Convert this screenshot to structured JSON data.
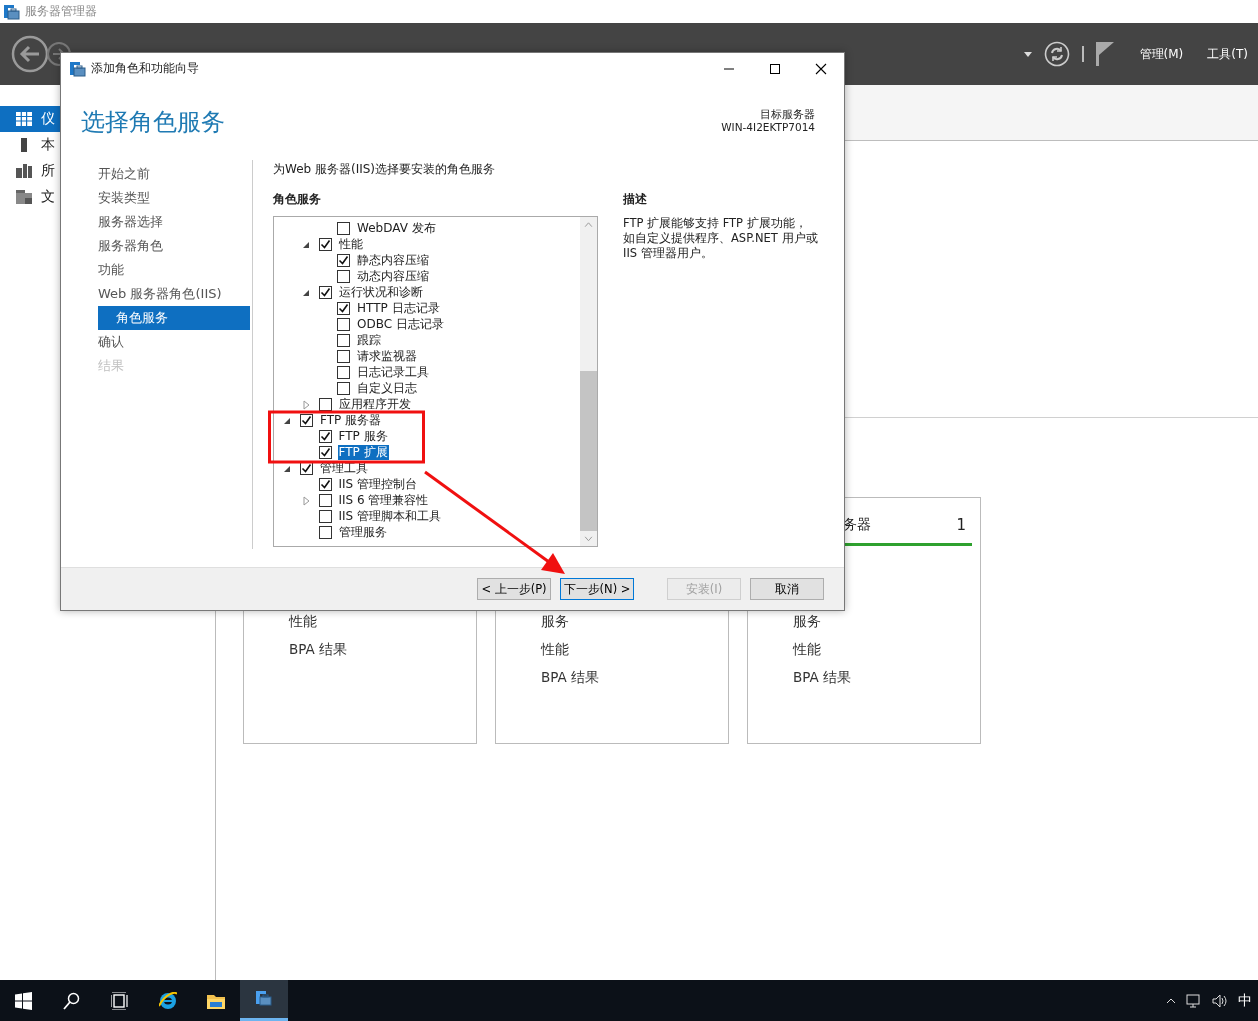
{
  "app_title": "服务器管理器",
  "header": {
    "menus": [
      "管理(M)",
      "工具(T)"
    ]
  },
  "sidebar": {
    "items": [
      {
        "label": "仪",
        "kind": "dashboard",
        "selected": true
      },
      {
        "label": "本",
        "kind": "server",
        "selected": false
      },
      {
        "label": "所",
        "kind": "servers",
        "selected": false
      },
      {
        "label": "文",
        "kind": "files",
        "selected": false
      }
    ]
  },
  "tiles": [
    {
      "lines": [
        "性能",
        "BPA 结果"
      ]
    },
    {
      "lines": [
        "服务",
        "性能",
        "BPA 结果"
      ]
    },
    {
      "title": "务器",
      "count": "1",
      "color": "#2ea12e",
      "lines": [
        "服务",
        "性能",
        "BPA 结果"
      ]
    }
  ],
  "dialog": {
    "title": "添加角色和功能向导",
    "heading": "选择角色服务",
    "target_label": "目标服务器",
    "target_name": "WIN-4I2EKTP7014",
    "steps": [
      {
        "label": "开始之前",
        "selected": false,
        "disabled": false
      },
      {
        "label": "安装类型",
        "selected": false,
        "disabled": false
      },
      {
        "label": "服务器选择",
        "selected": false,
        "disabled": false
      },
      {
        "label": "服务器角色",
        "selected": false,
        "disabled": false
      },
      {
        "label": "功能",
        "selected": false,
        "disabled": false
      },
      {
        "label": "Web 服务器角色(IIS)",
        "selected": false,
        "disabled": false,
        "children": [
          {
            "label": "角色服务",
            "selected": true,
            "disabled": false
          }
        ]
      },
      {
        "label": "确认",
        "selected": false,
        "disabled": false
      },
      {
        "label": "结果",
        "selected": false,
        "disabled": true
      }
    ],
    "instruction": "为Web 服务器(IIS)选择要安装的角色服务",
    "tree_label": "角色服务",
    "tree": [
      {
        "children": [
          {
            "children": [
              {
                "label": "WebDAV 发布",
                "checked": false,
                "selected": false
              }
            ]
          },
          {
            "label": "性能",
            "checked": true,
            "selected": false,
            "expanded": true,
            "children": [
              {
                "label": "静态内容压缩",
                "checked": true,
                "selected": false
              },
              {
                "label": "动态内容压缩",
                "checked": false,
                "selected": false
              }
            ]
          },
          {
            "label": "运行状况和诊断",
            "checked": true,
            "selected": false,
            "expanded": true,
            "children": [
              {
                "label": "HTTP 日志记录",
                "checked": true,
                "selected": false
              },
              {
                "label": "ODBC 日志记录",
                "checked": false,
                "selected": false
              },
              {
                "label": "跟踪",
                "checked": false,
                "selected": false
              },
              {
                "label": "请求监视器",
                "checked": false,
                "selected": false
              },
              {
                "label": "日志记录工具",
                "checked": false,
                "selected": false
              },
              {
                "label": "自定义日志",
                "checked": false,
                "selected": false
              }
            ]
          },
          {
            "label": "应用程序开发",
            "checked": false,
            "selected": false,
            "expanded": false
          }
        ]
      },
      {
        "label": "FTP 服务器",
        "checked": true,
        "selected": false,
        "expanded": true,
        "children": [
          {
            "label": "FTP 服务",
            "checked": true,
            "selected": false
          },
          {
            "label": "FTP 扩展",
            "checked": true,
            "selected": true
          }
        ]
      },
      {
        "label": "管理工具",
        "checked": true,
        "selected": false,
        "expanded": true,
        "children": [
          {
            "label": "IIS 管理控制台",
            "checked": true,
            "selected": false
          },
          {
            "label": "IIS 6 管理兼容性",
            "checked": false,
            "selected": false,
            "expanded": false
          },
          {
            "label": "IIS 管理脚本和工具",
            "checked": false,
            "selected": false
          },
          {
            "label": "管理服务",
            "checked": false,
            "selected": false
          }
        ]
      }
    ],
    "description_label": "描述",
    "description": "FTP 扩展能够支持 FTP 扩展功能，如自定义提供程序、ASP.NET 用户或 IIS 管理器用户。",
    "buttons": [
      {
        "label": "< 上一步(P)",
        "disabled": false,
        "focused": false
      },
      {
        "label": "下一步(N) >",
        "disabled": false,
        "focused": true
      },
      {
        "label": "安装(I)",
        "disabled": true,
        "focused": false
      },
      {
        "label": "取消",
        "disabled": false,
        "focused": false
      }
    ]
  },
  "taskbar": {
    "apps": [
      {
        "kind": "start",
        "selected": false
      },
      {
        "kind": "search",
        "selected": false
      },
      {
        "kind": "taskview",
        "selected": false
      },
      {
        "kind": "browser",
        "selected": false
      },
      {
        "kind": "folder",
        "selected": false
      },
      {
        "kind": "servermanager",
        "selected": true
      }
    ],
    "ime": "中"
  }
}
